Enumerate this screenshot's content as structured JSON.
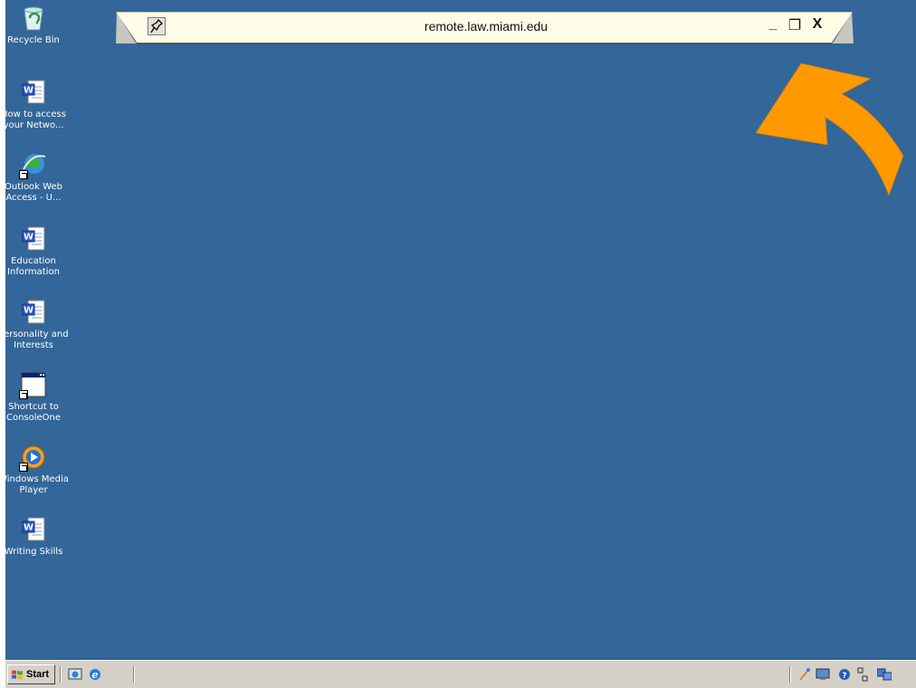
{
  "desktop": {
    "background_color": "#336699",
    "icons": [
      {
        "label": "Recycle Bin",
        "icon": "recycle-bin-icon"
      },
      {
        "label": "How to access\nyour Netwo...",
        "icon": "word-document-icon"
      },
      {
        "label": "Outlook Web\nAccess - U...",
        "icon": "internet-explorer-icon"
      },
      {
        "label": "Education\nInformation",
        "icon": "word-document-icon"
      },
      {
        "label": "Personality and\nInterests",
        "icon": "word-document-icon"
      },
      {
        "label": "Shortcut to\nConsoleOne",
        "icon": "application-window-icon"
      },
      {
        "label": "Windows Media\nPlayer",
        "icon": "media-player-icon"
      },
      {
        "label": "Writing Skills",
        "icon": "word-document-icon"
      }
    ]
  },
  "connection_bar": {
    "title": "remote.law.miami.edu",
    "pin_icon": "pin-icon",
    "minimize_label": "_",
    "restore_label": "❐",
    "close_label": "X",
    "bar_color": "#fffde8"
  },
  "annotation": {
    "arrow_color": "#ff9900"
  },
  "taskbar": {
    "start_label": "Start",
    "quick_launch": [
      "show-desktop-icon",
      "internet-explorer-icon"
    ],
    "tray_icons": [
      "network-icon",
      "display-icon",
      "help-icon",
      "sound-icon",
      "connection-icon"
    ]
  }
}
